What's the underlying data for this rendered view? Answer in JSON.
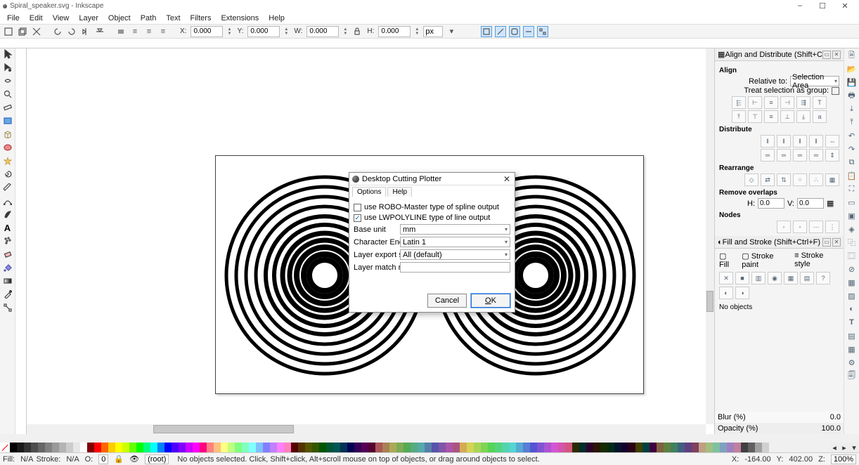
{
  "title": "Spiral_speaker.svg - Inkscape",
  "window_controls": {
    "min": "–",
    "max": "☐",
    "close": "✕"
  },
  "menus": [
    "File",
    "Edit",
    "View",
    "Layer",
    "Object",
    "Path",
    "Text",
    "Filters",
    "Extensions",
    "Help"
  ],
  "toolbar": {
    "x_label": "X:",
    "y_label": "Y:",
    "w_label": "W:",
    "h_label": "H:",
    "x_val": "0.000",
    "y_val": "0.000",
    "w_val": "0.000",
    "h_val": "0.000",
    "unit": "px"
  },
  "align_panel": {
    "title": "Align and Distribute (Shift+Ctrl+A)",
    "align_heading": "Align",
    "relative_label": "Relative to:",
    "relative_value": "Selection Area",
    "treat_label": "Treat selection as group:",
    "distribute_heading": "Distribute",
    "rearrange_heading": "Rearrange",
    "remove_heading": "Remove overlaps",
    "h_label": "H:",
    "h_val": "0.0",
    "v_label": "V:",
    "v_val": "0.0",
    "nodes_heading": "Nodes"
  },
  "fill_panel": {
    "title": "Fill and Stroke (Shift+Ctrl+F)",
    "fill_tab": "Fill",
    "stroke_paint_tab": "Stroke paint",
    "stroke_style_tab": "Stroke style",
    "no_objects": "No objects",
    "blur_label": "Blur (%)",
    "blur_val": "0.0",
    "opacity_label": "Opacity (%)",
    "opacity_val": "100.0"
  },
  "dialog": {
    "title": "Desktop Cutting Plotter",
    "tab_options": "Options",
    "tab_help": "Help",
    "cb1": "use ROBO-Master type of spline output",
    "cb2": "use LWPOLYLINE type of line output",
    "row_baseunit": "Base unit",
    "baseunit_val": "mm",
    "row_enc": "Character Encoding",
    "enc_val": "Latin 1",
    "row_layer": "Layer export selection",
    "layer_val": "All (default)",
    "row_match": "Layer match name",
    "match_val": "",
    "btn_cancel": "Cancel",
    "btn_ok": "OK"
  },
  "statusbar": {
    "fill_label": "Fill:",
    "fill_val": "N/A",
    "stroke_label": "Stroke:",
    "stroke_val": "N/A",
    "o_label": "O:",
    "o_val": "0",
    "layer": "(root)",
    "msg": "No objects selected. Click, Shift+click, Alt+scroll mouse on top of objects, or drag around objects to select.",
    "coord_x": "X:",
    "coord_xv": "-164.00",
    "coord_y": "Y:",
    "coord_yv": "402.00",
    "zoom_label": "Z:",
    "zoom_val": "100%"
  },
  "palette_colors": [
    "#000000",
    "#1a1a1a",
    "#333333",
    "#4d4d4d",
    "#666666",
    "#808080",
    "#999999",
    "#b3b3b3",
    "#cccccc",
    "#e6e6e6",
    "#ffffff",
    "#800000",
    "#ff0000",
    "#ff6600",
    "#ffcc00",
    "#ffff00",
    "#ccff00",
    "#66ff00",
    "#00ff00",
    "#00ff80",
    "#00ffff",
    "#0080ff",
    "#0000ff",
    "#4d00ff",
    "#8000ff",
    "#cc00ff",
    "#ff00ff",
    "#ff0080",
    "#ff8080",
    "#ffc080",
    "#ffff80",
    "#c0ff80",
    "#80ff80",
    "#80ffc0",
    "#80ffff",
    "#80c0ff",
    "#8080ff",
    "#c080ff",
    "#ff80ff",
    "#ff80c0",
    "#550000",
    "#553300",
    "#555500",
    "#335500",
    "#005500",
    "#005533",
    "#005555",
    "#003355",
    "#000055",
    "#330055",
    "#550055",
    "#550033",
    "#aa5555",
    "#aa8055",
    "#aaaa55",
    "#80aa55",
    "#55aa55",
    "#55aa80",
    "#55aaaa",
    "#5580aa",
    "#5555aa",
    "#8055aa",
    "#aa55aa",
    "#aa5580",
    "#d4aa55",
    "#d4d455",
    "#aad455",
    "#80d455",
    "#55d455",
    "#55d480",
    "#55d4aa",
    "#55d4d4",
    "#55aad4",
    "#5580d4",
    "#5555d4",
    "#8055d4",
    "#aa55d4",
    "#d455d4",
    "#d455aa",
    "#d45580",
    "#2b2b00",
    "#002b2b",
    "#2b002b",
    "#2b1500",
    "#152b00",
    "#002b15",
    "#00152b",
    "#15002b",
    "#2b0015",
    "#404000",
    "#004040",
    "#400040",
    "#806040",
    "#608040",
    "#408060",
    "#406080",
    "#604080",
    "#804060",
    "#c0a080",
    "#a0c080",
    "#80c0a0",
    "#80a0c0",
    "#a080c0",
    "#c080a0",
    "#404040",
    "#606060",
    "#a0a0a0",
    "#d0d0d0"
  ]
}
